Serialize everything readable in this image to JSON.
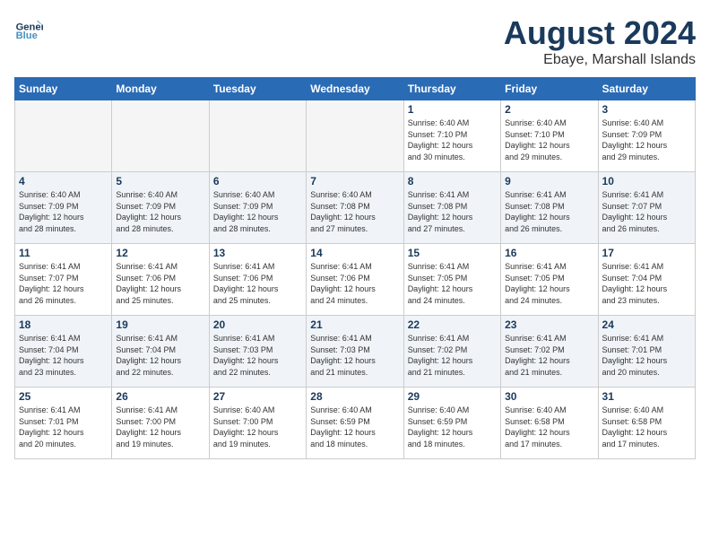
{
  "header": {
    "logo_line1": "General",
    "logo_line2": "Blue",
    "month_year": "August 2024",
    "location": "Ebaye, Marshall Islands"
  },
  "weekdays": [
    "Sunday",
    "Monday",
    "Tuesday",
    "Wednesday",
    "Thursday",
    "Friday",
    "Saturday"
  ],
  "weeks": [
    [
      {
        "day": "",
        "info": ""
      },
      {
        "day": "",
        "info": ""
      },
      {
        "day": "",
        "info": ""
      },
      {
        "day": "",
        "info": ""
      },
      {
        "day": "1",
        "info": "Sunrise: 6:40 AM\nSunset: 7:10 PM\nDaylight: 12 hours\nand 30 minutes."
      },
      {
        "day": "2",
        "info": "Sunrise: 6:40 AM\nSunset: 7:10 PM\nDaylight: 12 hours\nand 29 minutes."
      },
      {
        "day": "3",
        "info": "Sunrise: 6:40 AM\nSunset: 7:09 PM\nDaylight: 12 hours\nand 29 minutes."
      }
    ],
    [
      {
        "day": "4",
        "info": "Sunrise: 6:40 AM\nSunset: 7:09 PM\nDaylight: 12 hours\nand 28 minutes."
      },
      {
        "day": "5",
        "info": "Sunrise: 6:40 AM\nSunset: 7:09 PM\nDaylight: 12 hours\nand 28 minutes."
      },
      {
        "day": "6",
        "info": "Sunrise: 6:40 AM\nSunset: 7:09 PM\nDaylight: 12 hours\nand 28 minutes."
      },
      {
        "day": "7",
        "info": "Sunrise: 6:40 AM\nSunset: 7:08 PM\nDaylight: 12 hours\nand 27 minutes."
      },
      {
        "day": "8",
        "info": "Sunrise: 6:41 AM\nSunset: 7:08 PM\nDaylight: 12 hours\nand 27 minutes."
      },
      {
        "day": "9",
        "info": "Sunrise: 6:41 AM\nSunset: 7:08 PM\nDaylight: 12 hours\nand 26 minutes."
      },
      {
        "day": "10",
        "info": "Sunrise: 6:41 AM\nSunset: 7:07 PM\nDaylight: 12 hours\nand 26 minutes."
      }
    ],
    [
      {
        "day": "11",
        "info": "Sunrise: 6:41 AM\nSunset: 7:07 PM\nDaylight: 12 hours\nand 26 minutes."
      },
      {
        "day": "12",
        "info": "Sunrise: 6:41 AM\nSunset: 7:06 PM\nDaylight: 12 hours\nand 25 minutes."
      },
      {
        "day": "13",
        "info": "Sunrise: 6:41 AM\nSunset: 7:06 PM\nDaylight: 12 hours\nand 25 minutes."
      },
      {
        "day": "14",
        "info": "Sunrise: 6:41 AM\nSunset: 7:06 PM\nDaylight: 12 hours\nand 24 minutes."
      },
      {
        "day": "15",
        "info": "Sunrise: 6:41 AM\nSunset: 7:05 PM\nDaylight: 12 hours\nand 24 minutes."
      },
      {
        "day": "16",
        "info": "Sunrise: 6:41 AM\nSunset: 7:05 PM\nDaylight: 12 hours\nand 24 minutes."
      },
      {
        "day": "17",
        "info": "Sunrise: 6:41 AM\nSunset: 7:04 PM\nDaylight: 12 hours\nand 23 minutes."
      }
    ],
    [
      {
        "day": "18",
        "info": "Sunrise: 6:41 AM\nSunset: 7:04 PM\nDaylight: 12 hours\nand 23 minutes."
      },
      {
        "day": "19",
        "info": "Sunrise: 6:41 AM\nSunset: 7:04 PM\nDaylight: 12 hours\nand 22 minutes."
      },
      {
        "day": "20",
        "info": "Sunrise: 6:41 AM\nSunset: 7:03 PM\nDaylight: 12 hours\nand 22 minutes."
      },
      {
        "day": "21",
        "info": "Sunrise: 6:41 AM\nSunset: 7:03 PM\nDaylight: 12 hours\nand 21 minutes."
      },
      {
        "day": "22",
        "info": "Sunrise: 6:41 AM\nSunset: 7:02 PM\nDaylight: 12 hours\nand 21 minutes."
      },
      {
        "day": "23",
        "info": "Sunrise: 6:41 AM\nSunset: 7:02 PM\nDaylight: 12 hours\nand 21 minutes."
      },
      {
        "day": "24",
        "info": "Sunrise: 6:41 AM\nSunset: 7:01 PM\nDaylight: 12 hours\nand 20 minutes."
      }
    ],
    [
      {
        "day": "25",
        "info": "Sunrise: 6:41 AM\nSunset: 7:01 PM\nDaylight: 12 hours\nand 20 minutes."
      },
      {
        "day": "26",
        "info": "Sunrise: 6:41 AM\nSunset: 7:00 PM\nDaylight: 12 hours\nand 19 minutes."
      },
      {
        "day": "27",
        "info": "Sunrise: 6:40 AM\nSunset: 7:00 PM\nDaylight: 12 hours\nand 19 minutes."
      },
      {
        "day": "28",
        "info": "Sunrise: 6:40 AM\nSunset: 6:59 PM\nDaylight: 12 hours\nand 18 minutes."
      },
      {
        "day": "29",
        "info": "Sunrise: 6:40 AM\nSunset: 6:59 PM\nDaylight: 12 hours\nand 18 minutes."
      },
      {
        "day": "30",
        "info": "Sunrise: 6:40 AM\nSunset: 6:58 PM\nDaylight: 12 hours\nand 17 minutes."
      },
      {
        "day": "31",
        "info": "Sunrise: 6:40 AM\nSunset: 6:58 PM\nDaylight: 12 hours\nand 17 minutes."
      }
    ]
  ]
}
